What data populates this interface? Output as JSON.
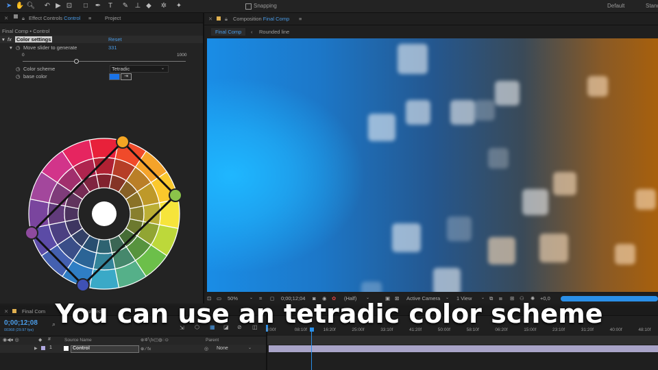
{
  "toolbar": {
    "snapping_label": "Snapping",
    "workspace_1": "Default",
    "workspace_2": "Stand"
  },
  "effect_controls": {
    "tab_label_prefix": "Effect Controls",
    "tab_label_layer": "Control",
    "project_tab": "Project",
    "breadcrumb": "Final Comp • Control",
    "effect_name": "Color settings",
    "reset_label": "Reset",
    "slider_label": "Move slider to generate",
    "slider_value": "331",
    "slider_min": "0",
    "slider_max": "1000",
    "slider_fraction": 0.331,
    "scheme_label": "Color scheme",
    "scheme_value": "Tetradic",
    "base_color_label": "base color",
    "base_color": "#1a73e8"
  },
  "composition": {
    "tab_label_prefix": "Composition",
    "tab_label_comp": "Final Comp",
    "breadcrumb_active": "Final Comp",
    "breadcrumb_next": "Rounded line"
  },
  "viewer_footer": {
    "zoom": "50%",
    "timecode": "0;00;12;04",
    "resolution": "(Half)",
    "camera": "Active Camera",
    "views": "1 View",
    "exposure": "+0,0"
  },
  "timeline": {
    "tab_label": "Final Com",
    "tab_label_2": "Rounded",
    "current_time": "0;00;12;08",
    "fps_info": "00368 (29.97 fps)",
    "col_source": "Source Name",
    "col_parent": "Parent",
    "layer_num": "1",
    "layer_name": "Control",
    "parent_value": "None",
    "ticks": [
      "0:00f",
      "08:10f",
      "16:20f",
      "25:00f",
      "33:10f",
      "41:20f",
      "50:00f",
      "58:10f",
      "06:20f",
      "15:00f",
      "23:10f",
      "31:20f",
      "40:00f",
      "48:10f"
    ]
  },
  "caption": "You can use an tetradic color scheme"
}
